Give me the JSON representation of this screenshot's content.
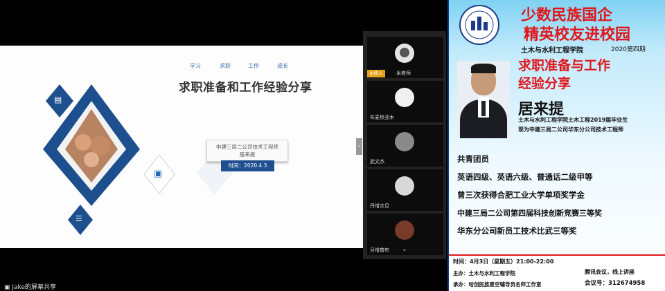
{
  "slide": {
    "nav": [
      "学习",
      "求职",
      "工作",
      "成长"
    ],
    "title": "求职准备和工作经验分享",
    "company": "中建三局二公司技术工程师",
    "speaker": "居来提",
    "date": "时间：2020.4.3"
  },
  "participants": [
    {
      "name": "米老师",
      "host_badge": "主持人"
    },
    {
      "name": "布麦热亚木"
    },
    {
      "name": "武文杰"
    },
    {
      "name": "丹增次旦"
    },
    {
      "name": "旦增普布"
    }
  ],
  "share_label": "Jake的屏幕共享",
  "poster": {
    "headline_1": "少数民族国企",
    "headline_2": "精英校友进校园",
    "college": "土木与水利工程学院",
    "issue": "2020第四期",
    "subtitle_1": "求职准备与工作",
    "subtitle_2": "经验分享",
    "name": "居来提",
    "bio_1": "土木与水利工程学院土木工程2019届毕业生",
    "bio_2": "现为中建三局二公司华东分公司技术工程师",
    "achievements": [
      "共青团员",
      "英语四级、英语六级、普通话二级甲等",
      "曾三次获得合肥工业大学单项奖学金",
      "中建三局二公司第四届科技创新竞赛三等奖",
      "华东分公司新员工技术比武三等奖"
    ],
    "time": "时间：4月3日（星期五）21:00-22:00",
    "host": "主办：土木与水利工程学院",
    "organizer": "承办：哈创民族星空辅导员名师工作室",
    "meeting": "腾讯会议，线上讲座",
    "meeting_id": "会议号：312674958"
  },
  "colors": {
    "red": "#e0161b",
    "navy": "#1e4f8f",
    "host": "#e4a21b"
  }
}
